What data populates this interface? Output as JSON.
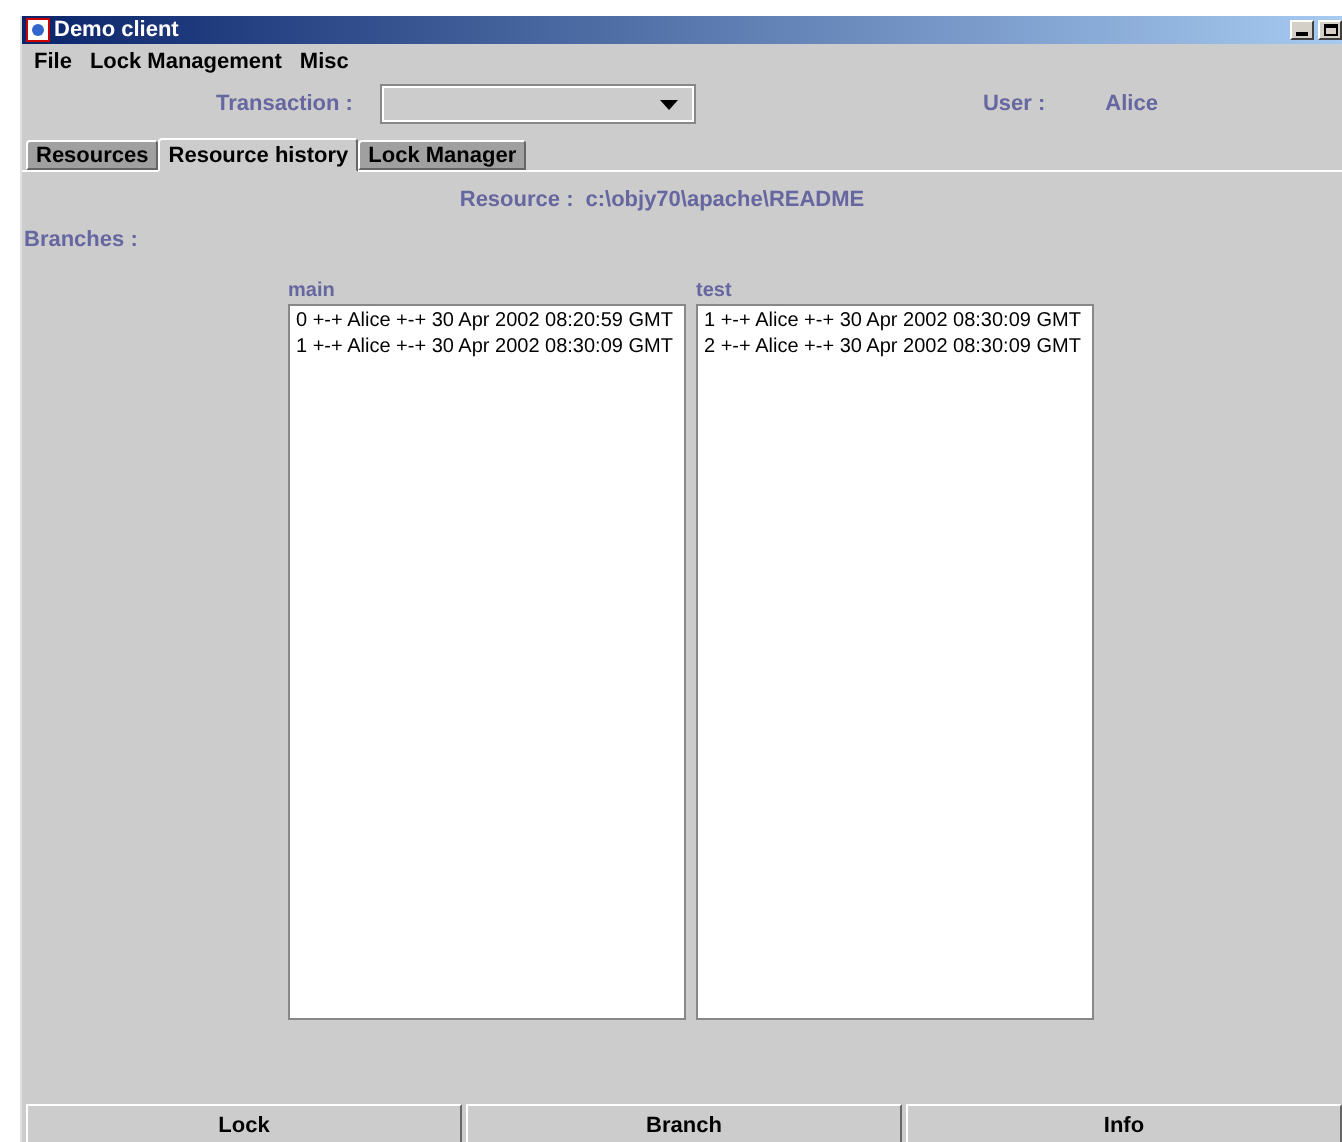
{
  "window": {
    "title": "Demo client"
  },
  "menu": [
    "File",
    "Lock Management",
    "Misc"
  ],
  "transaction": {
    "label": "Transaction :"
  },
  "user": {
    "label": "User :",
    "value": "Alice"
  },
  "tabs": [
    {
      "label": "Resources",
      "selected": false
    },
    {
      "label": "Resource history",
      "selected": true
    },
    {
      "label": "Lock Manager",
      "selected": false
    }
  ],
  "resource": {
    "label": "Resource :",
    "value": "c:\\objy70\\apache\\README"
  },
  "branches_label": "Branches :",
  "branches": [
    {
      "name": "main",
      "entries": [
        "0 +-+ Alice +-+ 30 Apr 2002 08:20:59 GMT",
        "1 +-+ Alice +-+ 30 Apr 2002 08:30:09 GMT"
      ]
    },
    {
      "name": "test",
      "entries": [
        "1 +-+ Alice +-+ 30 Apr 2002 08:30:09 GMT",
        "2 +-+ Alice +-+ 30 Apr 2002 08:30:09 GMT"
      ]
    }
  ],
  "buttons": [
    "Lock",
    "Branch",
    "Info"
  ]
}
